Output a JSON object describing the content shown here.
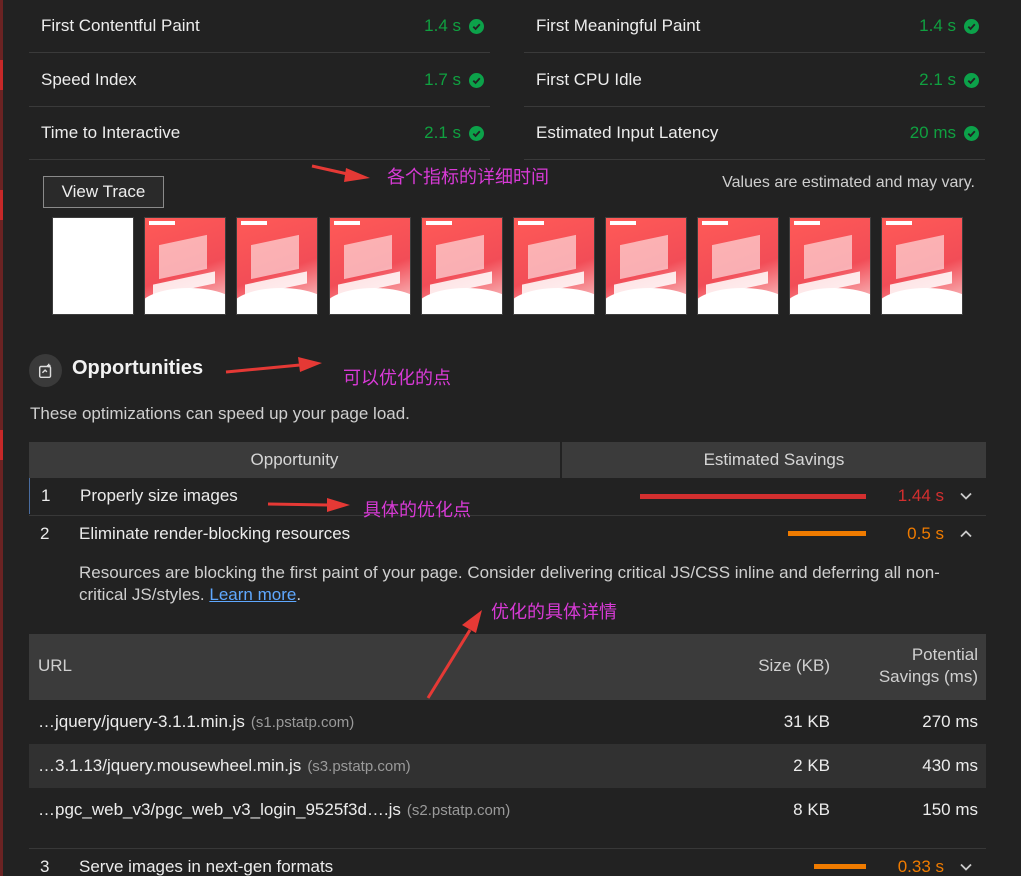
{
  "metrics": [
    {
      "label": "First Contentful Paint",
      "value": "1.4 s"
    },
    {
      "label": "First Meaningful Paint",
      "value": "1.4 s"
    },
    {
      "label": "Speed Index",
      "value": "1.7 s"
    },
    {
      "label": "First CPU Idle",
      "value": "2.1 s"
    },
    {
      "label": "Time to Interactive",
      "value": "2.1 s"
    },
    {
      "label": "Estimated Input Latency",
      "value": "20 ms"
    }
  ],
  "view_trace_label": "View Trace",
  "values_note": "Values are estimated and may vary.",
  "opportunities": {
    "title": "Opportunities",
    "description": "These optimizations can speed up your page load.",
    "col_opportunity": "Opportunity",
    "col_savings": "Estimated Savings",
    "items": [
      {
        "num": "1",
        "title": "Properly size images",
        "savings": "1.44 s",
        "bar_fraction": 0.99,
        "color": "#d32f2f"
      },
      {
        "num": "2",
        "title": "Eliminate render-blocking resources",
        "savings": "0.5 s",
        "bar_fraction": 0.34,
        "color": "#ef7b00"
      },
      {
        "num": "3",
        "title": "Serve images in next-gen formats",
        "savings": "0.33 s",
        "bar_fraction": 0.23,
        "color": "#ef7b00"
      }
    ],
    "detail": {
      "text": "Resources are blocking the first paint of your page. Consider delivering critical JS/CSS inline and deferring all non-critical JS/styles.",
      "link": "Learn more",
      "period": ".",
      "col_url": "URL",
      "col_size": "Size (KB)",
      "col_potential_1": "Potential",
      "col_potential_2": "Savings (ms)",
      "rows": [
        {
          "url": "…jquery/jquery-3.1.1.min.js",
          "host": "(s1.pstatp.com)",
          "size": "31 KB",
          "savings": "270 ms"
        },
        {
          "url": "…3.1.13/jquery.mousewheel.min.js",
          "host": "(s3.pstatp.com)",
          "size": "2 KB",
          "savings": "430 ms"
        },
        {
          "url": "…pgc_web_v3/pgc_web_v3_login_9525f3d….js",
          "host": "(s2.pstatp.com)",
          "size": "8 KB",
          "savings": "150 ms"
        }
      ]
    }
  },
  "annotations": {
    "metrics_detail": "各个指标的详细时间",
    "opportunities": "可以优化的点",
    "specific": "具体的优化点",
    "details": "优化的具体详情"
  },
  "colors": {
    "pass": "#0ca24a",
    "fail": "#d32f2f",
    "average": "#ef7b00",
    "annotation": "#d83ad6",
    "arrow": "#e53935"
  }
}
